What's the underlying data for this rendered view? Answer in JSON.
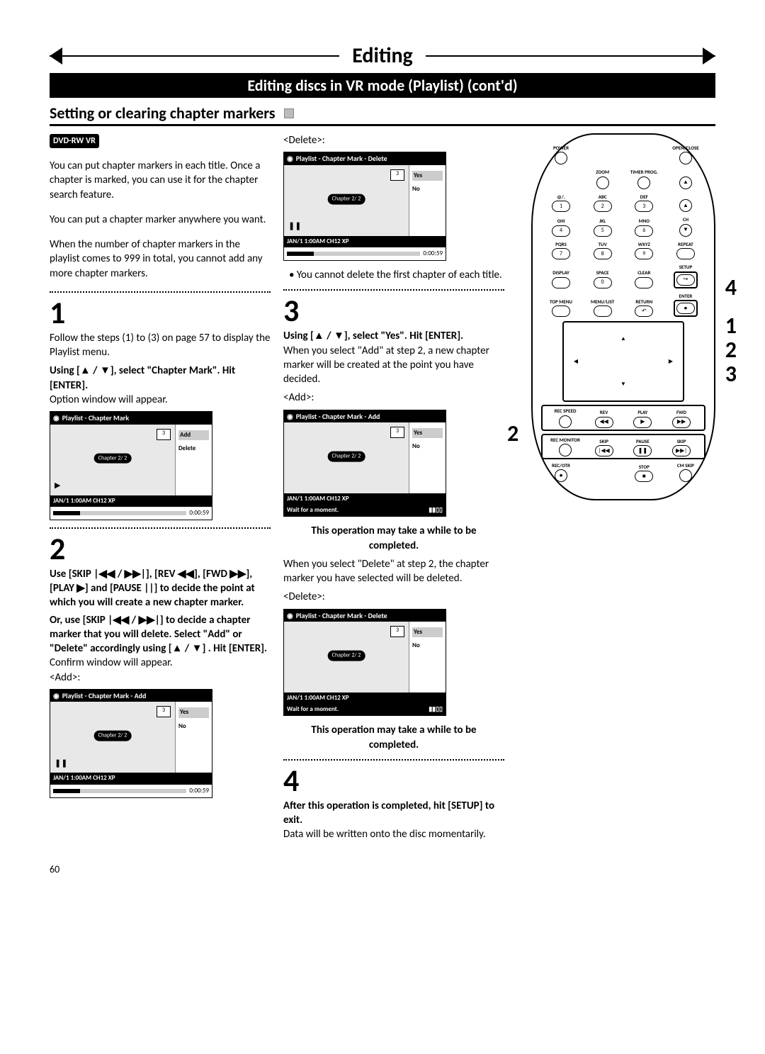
{
  "header": {
    "title": "Editing",
    "subtitle": "Editing discs in VR mode (Playlist) (cont'd)",
    "section": "Setting or clearing chapter markers"
  },
  "dvdrw_badge": "DVD-RW VR",
  "intro": {
    "p1": "You can put chapter markers in each title. Once a chapter is marked, you can use it for the chapter search feature.",
    "p2": "You can put a chapter marker anywhere you want.",
    "p3": "When the number of chapter markers in the playlist comes to 999 in total, you cannot add any more chapter markers."
  },
  "step1": {
    "num": "1",
    "lead": "Follow the steps (1) to (3) on page 57 to display the Playlist menu.",
    "instr": "Using [▲ / ▼], select \"Chapter Mark\". Hit [ENTER].",
    "result": "Option window will appear."
  },
  "step2": {
    "num": "2",
    "instr1": "Use [SKIP |◀◀ / ▶▶|], [REV ◀◀], [FWD ▶▶], [PLAY ▶] and [PAUSE ||] to decide the point at which you will create a new chapter marker.",
    "instr2": "Or, use [SKIP |◀◀ / ▶▶|] to decide a chapter marker that you will delete. Select \"Add\" or \"Delete\" accordingly using [▲ / ▼] . Hit [ENTER].",
    "result": "Confirm window will appear."
  },
  "step2_note": "• You cannot delete the first chapter of each title.",
  "step3": {
    "num": "3",
    "instr": "Using [▲ / ▼], select \"Yes\". Hit [ENTER].",
    "add_desc": "When you select \"Add\" at step 2, a new chapter marker will be created at the point you have decided.",
    "del_desc": "When you select \"Delete\" at step 2, the chapter marker you have selected will be deleted.",
    "wait": "This operation may take a while to be completed."
  },
  "step4": {
    "num": "4",
    "instr": "After this operation is completed, hit [SETUP] to exit.",
    "result": "Data will be written onto the disc momentarily."
  },
  "osd": {
    "title_mark": "Playlist - Chapter Mark",
    "title_add": "Playlist - Chapter Mark - Add",
    "title_delete": "Playlist - Chapter Mark - Delete",
    "add": "Add",
    "delete": "Delete",
    "yes": "Yes",
    "no": "No",
    "chapter": "Chapter    2/ 2",
    "footer": "JAN/1 1:00AM CH12 XP",
    "time": "0:00:59",
    "wait": "Wait for a moment.",
    "thumb": "3"
  },
  "labels": {
    "add": "<Add>:",
    "delete": "<Delete>:"
  },
  "remote": {
    "power": "POWER",
    "openclose": "OPEN/CLOSE",
    "zoom": "ZOOM",
    "timer_prog": "TIMER PROG.",
    "at": "@/.",
    "abc": "ABC",
    "def": "DEF",
    "ghi": "GHI",
    "jkl": "JKL",
    "mno": "MNO",
    "pqrs": "PQRS",
    "tuv": "TUV",
    "wxyz": "WXYZ",
    "ch": "CH",
    "repeat": "REPEAT",
    "display": "DISPLAY",
    "space": "SPACE",
    "clear": "CLEAR",
    "setup": "SETUP",
    "topmenu": "TOP MENU",
    "menulist": "MENU/LIST",
    "return": "RETURN",
    "enter": "ENTER",
    "recspeed": "REC SPEED",
    "rev": "REV",
    "play": "PLAY",
    "fwd": "FWD",
    "recmonitor": "REC MONITOR",
    "skip": "SKIP",
    "pause": "PAUSE",
    "recotr": "REC/OTR",
    "stop": "STOP",
    "cmskip": "CM SKIP",
    "n1": "1",
    "n2": "2",
    "n3": "3",
    "n4": "4",
    "n5": "5",
    "n6": "6",
    "n7": "7",
    "n8": "8",
    "n9": "9",
    "n0": "0"
  },
  "callouts": {
    "c4": "4",
    "c1": "1",
    "c2": "2",
    "c3": "3",
    "cleft2": "2"
  },
  "pagenum": "60"
}
